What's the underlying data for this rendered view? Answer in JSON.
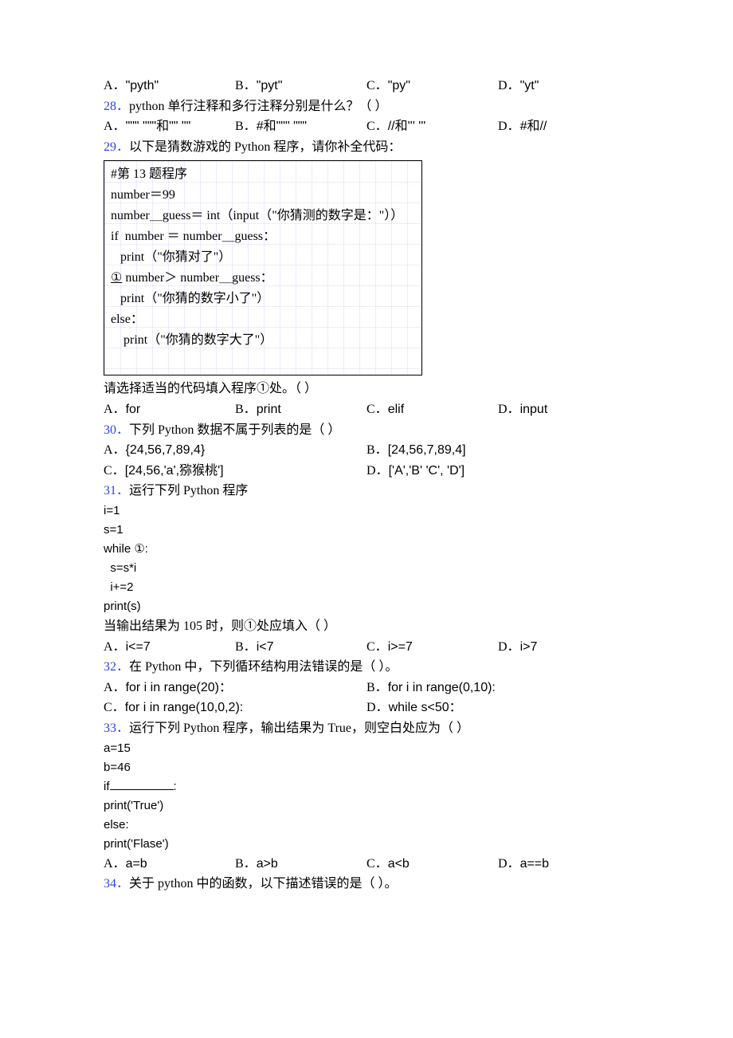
{
  "pre27_options": {
    "a_label": "A．",
    "a_text": "\"pyth\"",
    "b_label": "B．",
    "b_text": "\"pyt\"",
    "c_label": "C．",
    "c_text": "\"py\"",
    "d_label": "D．",
    "d_text": "\"yt\""
  },
  "q28": {
    "num": "28．",
    "text": "python 单行注释和多行注释分别是什么？（  ）",
    "a_label": "A．",
    "a_text": "\"\"\" \"\"\"和\"\" \"\"",
    "b_label": "B．",
    "b_text": "#和\"\"\" \"\"\"",
    "c_label": "C．",
    "c_text": "//和''' '''",
    "d_label": "D．",
    "d_text": "#和//"
  },
  "q29": {
    "num": "29．",
    "text": "以下是猜数游戏的 Python 程序，请你补全代码：",
    "code": {
      "l1": "#第 13 题程序",
      "l2": "number＝99",
      "l3": "number＿guess＝ int（input（\"你猜测的数字是：\"））",
      "l4": "if  number ＝ number＿guess：",
      "l5": "   print（\"你猜对了\"）",
      "l6a": "①",
      "l6b": " number＞ number＿guess：",
      "l7": "   print（\"你猜的数字小了\"）",
      "l8": "else：",
      "l9": "    print（\"你猜的数字大了\"）"
    },
    "post_text": "请选择适当的代码填入程序①处。（   ）",
    "a_label": "A．",
    "a_text": "for",
    "b_label": "B．",
    "b_text": "print",
    "c_label": "C．",
    "c_text": "elif",
    "d_label": "D．",
    "d_text": "input"
  },
  "q30": {
    "num": "30．",
    "text": "下列 Python 数据不属于列表的是（     ）",
    "a_label": "A．",
    "a_text": "{24,56,7,89,4}",
    "b_label": "B．",
    "b_text": "[24,56,7,89,4]",
    "c_label": "C．",
    "c_text": "[24,56,'a',猕猴桃']",
    "d_label": "D．",
    "d_text": "['A','B' 'C', 'D']"
  },
  "q31": {
    "num": "31．",
    "text": "运行下列 Python 程序",
    "code": {
      "l1": "i=1",
      "l2": "s=1",
      "l3": "while ①:",
      "l4": "  s=s*i",
      "l5": "  i+=2",
      "l6": "print(s)"
    },
    "post_text": "当输出结果为 105 时，则①处应填入（   ）",
    "a_label": "A．",
    "a_text": "i<=7",
    "b_label": "B．",
    "b_text": "i<7",
    "c_label": "C．",
    "c_text": "i>=7",
    "d_label": "D．",
    "d_text": "i>7"
  },
  "q32": {
    "num": "32．",
    "text": "在 Python 中，下列循环结构用法错误的是（  ）。",
    "a_label": "A．",
    "a_text": "for i in range(20)：",
    "b_label": "B．",
    "b_text": "for i in range(0,10):",
    "c_label": "C．",
    "c_text": "for i in range(10,0,2):",
    "d_label": "D．",
    "d_text": "while s<50："
  },
  "q33": {
    "num": "33．",
    "text": "运行下列 Python 程序，输出结果为 True，则空白处应为（   ）",
    "code": {
      "l1": "a=15",
      "l2": "b=46",
      "l3a": "if",
      "l3b": ":",
      "l4": "print('True')",
      "l5": "else:",
      "l6": "print('Flase')"
    },
    "a_label": "A．",
    "a_text": "a=b",
    "b_label": "B．",
    "b_text": "a>b",
    "c_label": "C．",
    "c_text": "a<b",
    "d_label": "D．",
    "d_text": "a==b"
  },
  "q34": {
    "num": "34．",
    "text": "关于 python 中的函数，以下描述错误的是（  ）。"
  }
}
